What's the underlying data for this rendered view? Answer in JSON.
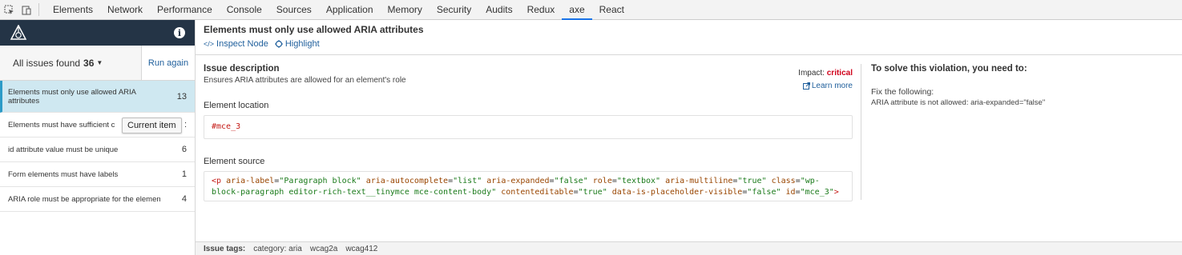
{
  "devtools": {
    "tabs": [
      "Elements",
      "Network",
      "Performance",
      "Console",
      "Sources",
      "Application",
      "Memory",
      "Security",
      "Audits",
      "Redux",
      "axe",
      "React"
    ],
    "active_tab": "axe",
    "accent": "#1a73e8"
  },
  "sidebar": {
    "brand_color": "#243446",
    "issues_label": "All issues found",
    "issues_count": "36",
    "run_again": "Run again",
    "items": [
      {
        "label": "Elements must only use allowed ARIA attributes",
        "count": "13",
        "selected": true
      },
      {
        "label": "Elements must have sufficient c",
        "count": ":"
      },
      {
        "label": "id attribute value must be unique",
        "count": "6"
      },
      {
        "label": "Form elements must have labels",
        "count": "1"
      },
      {
        "label": "ARIA role must be appropriate for the element",
        "count": "4"
      }
    ],
    "tooltip": "Current item"
  },
  "main": {
    "title": "Elements must only use allowed ARIA attributes",
    "inspect_node": "Inspect Node",
    "highlight": "Highlight",
    "issue_description_title": "Issue description",
    "issue_description": "Ensures ARIA attributes are allowed for an element's role",
    "impact_label": "Impact:",
    "impact_value": "critical",
    "impact_color": "#d0021b",
    "learn_more": "Learn more",
    "element_location_label": "Element location",
    "element_location": "#mce_3",
    "element_source_label": "Element source",
    "element_source": "<p aria-label=\"Paragraph block\" aria-autocomplete=\"list\" aria-expanded=\"false\" role=\"textbox\" aria-multiline=\"true\" class=\"wp-block-paragraph editor-rich-text__tinymce mce-content-body\" contenteditable=\"true\" data-is-placeholder-visible=\"false\" id=\"mce_3\">",
    "solve_title": "To solve this violation, you need to:",
    "fix_label": "Fix the following:",
    "fix_detail": "ARIA attribute is not allowed: aria-expanded=\"false\"",
    "tags_label": "Issue tags:",
    "tags": [
      "category: aria",
      "wcag2a",
      "wcag412"
    ]
  }
}
